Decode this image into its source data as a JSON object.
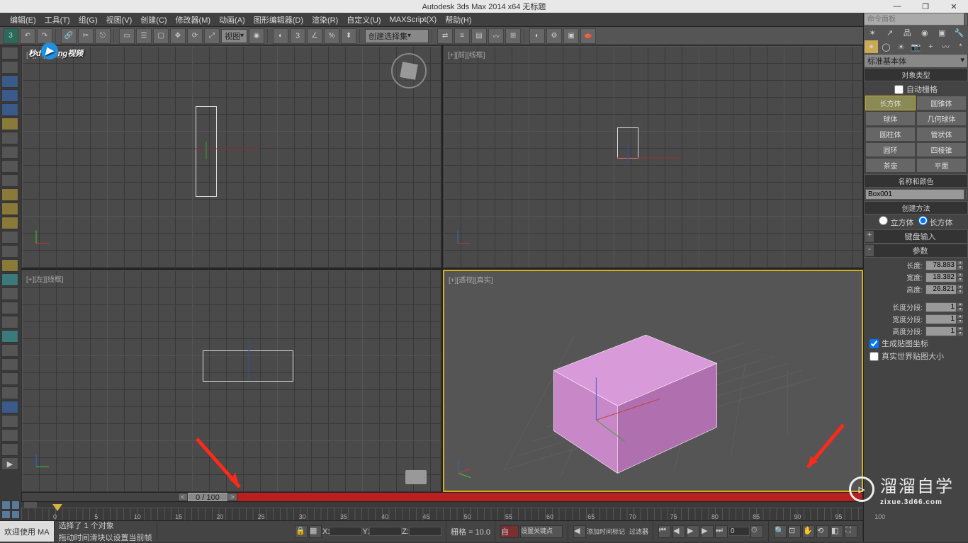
{
  "title": "Autodesk 3ds Max  2014 x64     无标题",
  "window_controls": {
    "min": "—",
    "max": "❐",
    "close": "✕"
  },
  "menu": [
    "编辑(E)",
    "工具(T)",
    "组(G)",
    "视图(V)",
    "创建(C)",
    "修改器(M)",
    "动画(A)",
    "图形编辑器(D)",
    "渲染(R)",
    "自定义(U)",
    "MAXScript(X)",
    "帮助(H)"
  ],
  "toolbar": {
    "dropdown1": "视图",
    "dropdown2": "创建选择集",
    "three_label": "3"
  },
  "viewports": {
    "top": "[+][顶][线框]",
    "front": "[+][前][线框]",
    "left": "[+][左][线框]",
    "persp": "[+][透视][真实]"
  },
  "command_panel": {
    "search_placeholder": "命令面板",
    "std_dropdown": "标准基本体",
    "sections": {
      "object_type": "对象类型",
      "autogrid": "自动栅格",
      "name_color": "名称和颜色",
      "creation_method": "创建方法",
      "keyboard_entry": "键盘输入",
      "params": "参数"
    },
    "object_buttons": [
      [
        "长方体",
        "圆锥体"
      ],
      [
        "球体",
        "几何球体"
      ],
      [
        "圆柱体",
        "管状体"
      ],
      [
        "圆环",
        "四棱锥"
      ],
      [
        "茶壶",
        "平面"
      ]
    ],
    "object_name": "Box001",
    "creation_radio": {
      "cube": "立方体",
      "box": "长方体"
    },
    "params": {
      "length_label": "长度:",
      "length_val": "78.883",
      "width_label": "宽度:",
      "width_val": "18.382",
      "height_label": "高度:",
      "height_val": "26.821",
      "lseg_label": "长度分段:",
      "lseg_val": "1",
      "wseg_label": "宽度分段:",
      "wseg_val": "1",
      "hseg_label": "高度分段:",
      "hseg_val": "1",
      "gen_uvw": "生成贴图坐标",
      "real_world": "真实世界贴图大小"
    }
  },
  "timeline": {
    "current": "0 / 100",
    "ticks": [
      0,
      5,
      10,
      15,
      20,
      25,
      30,
      35,
      40,
      45,
      50,
      55,
      60,
      65,
      70,
      75,
      80,
      85,
      90,
      95,
      100
    ]
  },
  "status": {
    "welcome": "欢迎使用 MA",
    "selected": "选择了 1 个对象",
    "hint": "拖动时间滑块以设置当前帧",
    "x_label": "X:",
    "y_label": "Y:",
    "z_label": "Z:",
    "grid_label": "栅格 = 10.0",
    "auto_key": "自",
    "set_key": "设置关键点",
    "add_time": "添加时间标记",
    "filter": "过滤器"
  },
  "watermarks": {
    "wm1": "秒 d▶ng 视频",
    "wm2_main": "溜溜自学",
    "wm2_sub": "zixue.3d66.com"
  }
}
